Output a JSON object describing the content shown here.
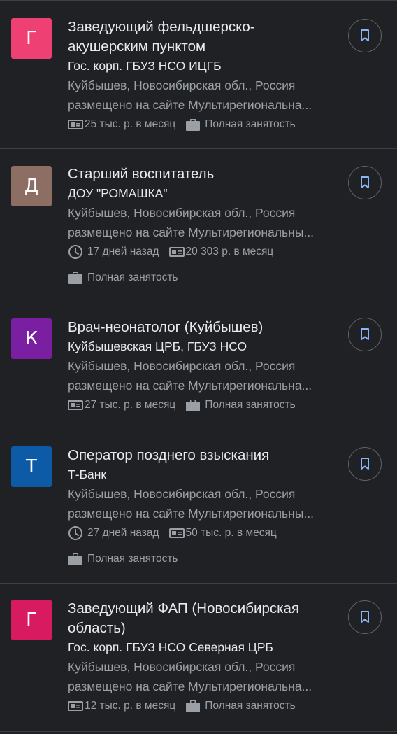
{
  "jobs": [
    {
      "avatar_letter": "Г",
      "avatar_color": "#ef4074",
      "title": "Заведующий фельдшерско-акушерским пунктом",
      "company": "Гос. корп. ГБУЗ НСО ИЦГБ",
      "location": "Куйбышев, Новосибирская обл., Россия",
      "source": "размещено на сайте Мультирегиональна...",
      "salary": "25 тыс. р. в месяц",
      "employment": "Полная занятость"
    },
    {
      "avatar_letter": "Д",
      "avatar_color": "#8d6e63",
      "title": "Старший воспитатель",
      "company": "ДОУ \"РОМАШКА\"",
      "location": "Куйбышев, Новосибирская обл., Россия",
      "source": "размещено на сайте Мультирегиональны...",
      "posted": "17 дней назад",
      "salary": "20 303 р. в месяц",
      "employment": "Полная занятость"
    },
    {
      "avatar_letter": "К",
      "avatar_color": "#7b1fa2",
      "title": "Врач-неонатолог (Куйбышев)",
      "company": "Куйбышевская ЦРБ, ГБУЗ НСО",
      "location": "Куйбышев, Новосибирская обл., Россия",
      "source": "размещено на сайте Мультирегиональна...",
      "salary": "27 тыс. р. в месяц",
      "employment": "Полная занятость"
    },
    {
      "avatar_letter": "Т",
      "avatar_color": "#0d5aa7",
      "title": "Оператор позднего взыскания",
      "company": "Т-Банк",
      "location": "Куйбышев, Новосибирская обл., Россия",
      "source": "размещено на сайте Мультирегиональны...",
      "posted": "27 дней назад",
      "salary": "50 тыс. р. в месяц",
      "employment": "Полная занятость"
    },
    {
      "avatar_letter": "Г",
      "avatar_color": "#d81b60",
      "title": "Заведующий ФАП (Новосибирская область)",
      "company": "Гос. корп. ГБУЗ НСО Северная ЦРБ",
      "location": "Куйбышев, Новосибирская обл., Россия",
      "source": "размещено на сайте Мультирегиональна...",
      "salary": "12 тыс. р. в месяц",
      "employment": "Полная занятость"
    }
  ],
  "icons": {
    "bookmark": "bookmark-icon",
    "salary": "cash-icon",
    "employment": "briefcase-icon",
    "posted": "clock-icon"
  }
}
